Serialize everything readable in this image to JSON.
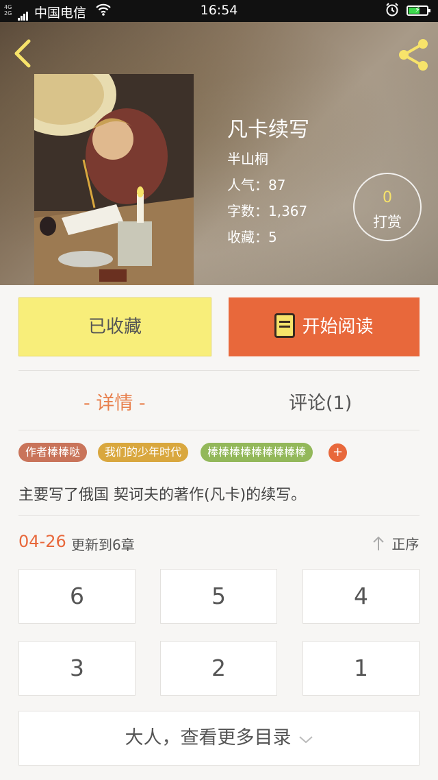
{
  "status_bar": {
    "network": "4G 2G",
    "carrier": "中国电信",
    "time": "16:54",
    "icons": [
      "signal-icon",
      "wifi-icon",
      "alarm-icon",
      "battery-charging-icon"
    ],
    "battery_color": "#3bd94c"
  },
  "header": {
    "back_icon": "chevron-left-icon",
    "share_icon": "share-icon",
    "icon_color": "#f7e36a"
  },
  "book": {
    "title": "凡卡续写",
    "author": "半山桐",
    "popularity_label": "人气：",
    "popularity": "87",
    "word_count_label": "字数：",
    "word_count": "1,367",
    "favorites_label": "收藏：",
    "favorites": "5"
  },
  "tip": {
    "count": "0",
    "label": "打赏"
  },
  "actions": {
    "collected_label": "已收藏",
    "read_label": "开始阅读",
    "read_color": "#e8683b",
    "collected_color": "#f8ee7a"
  },
  "tabs": {
    "detail": "- 详情 -",
    "comments": "评论(1)",
    "active_color": "#e8804d"
  },
  "tags": [
    {
      "label": "作者棒棒哒",
      "color": "#c9745a"
    },
    {
      "label": "我们的少年时代",
      "color": "#d9a73e"
    },
    {
      "label": "棒棒棒棒棒棒棒棒棒",
      "color": "#93b85a"
    }
  ],
  "tag_add": "+",
  "summary": "主要写了俄国 契诃夫的著作(凡卡)的续写。",
  "update": {
    "date": "04-26",
    "text": "更新到6章",
    "sort_label": "正序",
    "sort_icon": "arrow-up-icon"
  },
  "chapters": [
    "6",
    "5",
    "4",
    "3",
    "2",
    "1"
  ],
  "more_label": "大人，查看更多目录",
  "more_icon": "chevron-down-icon"
}
